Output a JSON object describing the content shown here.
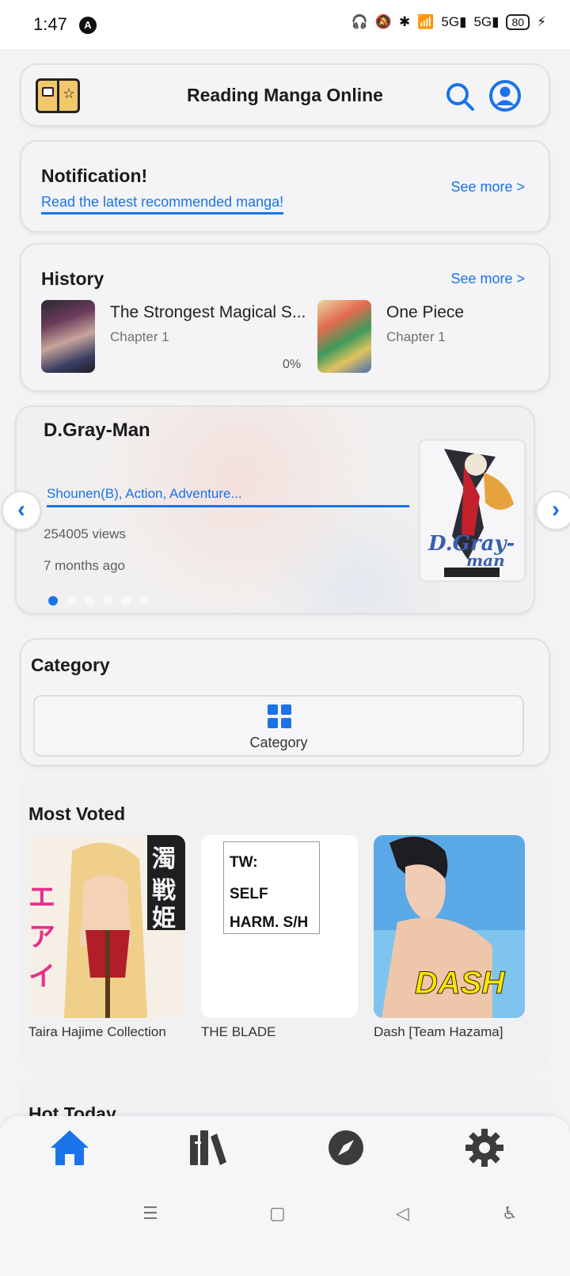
{
  "status_bar": {
    "time": "1:47",
    "network_a": "5G",
    "network_b": "5G",
    "battery": "80"
  },
  "header": {
    "title": "Reading Manga Online"
  },
  "notification": {
    "heading": "Notification!",
    "link": "Read the latest recommended manga!",
    "see_more": "See more >"
  },
  "history": {
    "heading": "History",
    "see_more": "See more >",
    "items": [
      {
        "name": "The Strongest Magical S...",
        "chapter": "Chapter 1",
        "progress": "0%"
      },
      {
        "name": "One Piece",
        "chapter": "Chapter 1"
      }
    ]
  },
  "featured": {
    "title": "D.Gray-Man",
    "genres": "Shounen(B), Action, Adventure...",
    "views": "254005 views",
    "updated": "7 months ago",
    "slide_index": 1,
    "slide_count": 6
  },
  "category": {
    "heading": "Category",
    "button_label": "Category"
  },
  "most_voted": {
    "heading": "Most Voted",
    "items": [
      {
        "title": "Taira Hajime Collection"
      },
      {
        "title": "THE BLADE",
        "cover_text": [
          "TW:",
          "SELF",
          "HARM. S/H"
        ]
      },
      {
        "title": "Dash [Team Hazama]",
        "cover_text": [
          "DASH"
        ]
      }
    ]
  },
  "hot_today": {
    "heading": "Hot Today"
  },
  "colors": {
    "accent": "#1a73e8",
    "card_bg": "#f4f4f6",
    "icon_dark": "#3c3c3c"
  },
  "bottom_nav": {
    "tabs": [
      "home",
      "library",
      "explore",
      "settings"
    ],
    "active": "home"
  }
}
